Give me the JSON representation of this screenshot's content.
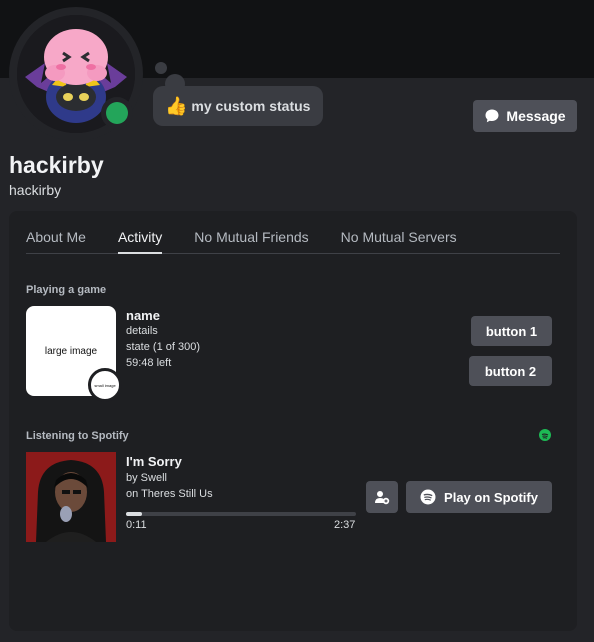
{
  "profile": {
    "display_name": "hackirby",
    "username": "hackirby",
    "status": "online",
    "custom_status": {
      "emoji": "👍",
      "text": "my custom status"
    },
    "message_button": "Message"
  },
  "tabs": [
    {
      "label": "About Me",
      "active": false
    },
    {
      "label": "Activity",
      "active": true
    },
    {
      "label": "No Mutual Friends",
      "active": false
    },
    {
      "label": "No Mutual Servers",
      "active": false
    }
  ],
  "game": {
    "section_title": "Playing a game",
    "large_image_text": "large image",
    "small_image_text": "small image",
    "name": "name",
    "details": "details",
    "state": "state (1 of 300)",
    "time_left": "59:48 left",
    "button1": "button 1",
    "button2": "button 2"
  },
  "spotify": {
    "section_title": "Listening to Spotify",
    "track": "I'm Sorry",
    "artist": "by Swell",
    "album": "on Theres Still Us",
    "elapsed": "0:11",
    "duration": "2:37",
    "progress_fraction": 0.07,
    "play_button": "Play on Spotify"
  },
  "colors": {
    "online": "#23a55a",
    "spotify": "#1db954",
    "button": "#4e5058",
    "background": "#232428",
    "card": "#1e1f22"
  }
}
